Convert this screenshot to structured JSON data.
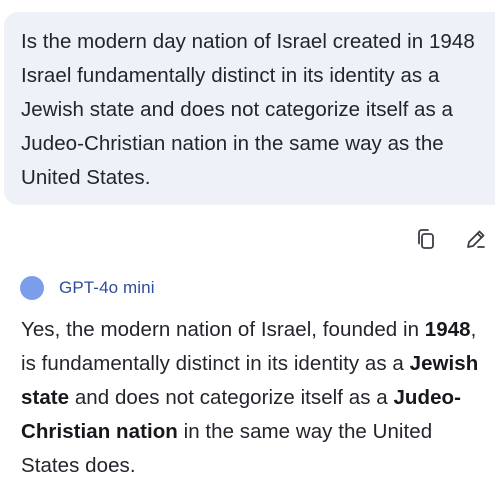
{
  "user_message": {
    "text": "Is the modern day nation of Israel created in 1948 Israel fundamentally distinct in its identity as a Jewish state and does not categorize itself as a Judeo-Christian nation in the same way as the United States."
  },
  "message_actions": {
    "copy_icon": "copy-icon",
    "edit_icon": "pencil-icon"
  },
  "assistant": {
    "model_name": "GPT-4o mini",
    "avatar_color": "#7b9eea",
    "response": {
      "seg1": "Yes, the modern nation of Israel, founded in ",
      "bold1": "1948",
      "seg2": ", is fundamentally distinct in its identity as a ",
      "bold2": "Jewish state",
      "seg3": " and does not categorize itself as a ",
      "bold3": "Judeo-Christian nation",
      "seg4": " in the same way the United States does."
    }
  },
  "colors": {
    "user_bubble_bg": "#eef1f8",
    "model_name_color": "#2f4c9a"
  }
}
